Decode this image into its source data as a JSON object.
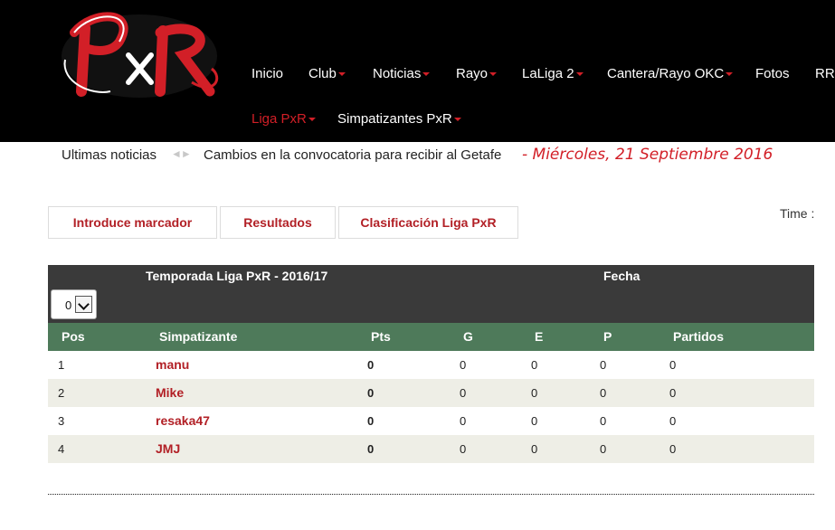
{
  "logo": {
    "text": "PxR",
    "colors": {
      "red": "#d21f27",
      "white": "#ffffff"
    }
  },
  "nav": {
    "row1": [
      {
        "label": "Inicio",
        "dropdown": false
      },
      {
        "label": "Club",
        "dropdown": true
      },
      {
        "label": "Noticias",
        "dropdown": true
      },
      {
        "label": "Rayo",
        "dropdown": true
      },
      {
        "label": "LaLiga 2",
        "dropdown": true
      },
      {
        "label": "Cantera/Rayo OKC",
        "dropdown": true
      },
      {
        "label": "Fotos",
        "dropdown": false
      },
      {
        "label": "RRSS",
        "dropdown": false
      }
    ],
    "row2": [
      {
        "label": "Liga PxR",
        "dropdown": true,
        "active": true
      },
      {
        "label": "Simpatizantes PxR",
        "dropdown": true,
        "active": false
      }
    ]
  },
  "ticker": {
    "label": "Ultimas noticias",
    "arrows": "◄►",
    "headline": "Cambios en la convocatoria para recibir al Getafe",
    "date": "- Miércoles, 21 Septiembre 2016"
  },
  "tabs": [
    {
      "label": "Introduce marcador"
    },
    {
      "label": "Resultados"
    },
    {
      "label": "Clasificación Liga PxR"
    }
  ],
  "time_label": "Time :",
  "season": {
    "title": "Temporada Liga PxR - 2016/17",
    "fecha_label": "Fecha",
    "round_value": "0"
  },
  "table": {
    "headers": [
      "Pos",
      "Simpatizante",
      "Pts",
      "G",
      "E",
      "P",
      "Partidos"
    ],
    "rows": [
      {
        "pos": "1",
        "name": "manu",
        "pts": "0",
        "g": "0",
        "e": "0",
        "p": "0",
        "partidos": "0"
      },
      {
        "pos": "2",
        "name": "Mike",
        "pts": "0",
        "g": "0",
        "e": "0",
        "p": "0",
        "partidos": "0"
      },
      {
        "pos": "3",
        "name": "resaka47",
        "pts": "0",
        "g": "0",
        "e": "0",
        "p": "0",
        "partidos": "0"
      },
      {
        "pos": "4",
        "name": "JMJ",
        "pts": "0",
        "g": "0",
        "e": "0",
        "p": "0",
        "partidos": "0"
      }
    ]
  },
  "colors": {
    "header_bg": "#000000",
    "accent_red": "#d21f27",
    "table_header_green": "#4e7a5a",
    "season_bar": "#3a3a3a",
    "alt_row": "#eeeee6"
  }
}
